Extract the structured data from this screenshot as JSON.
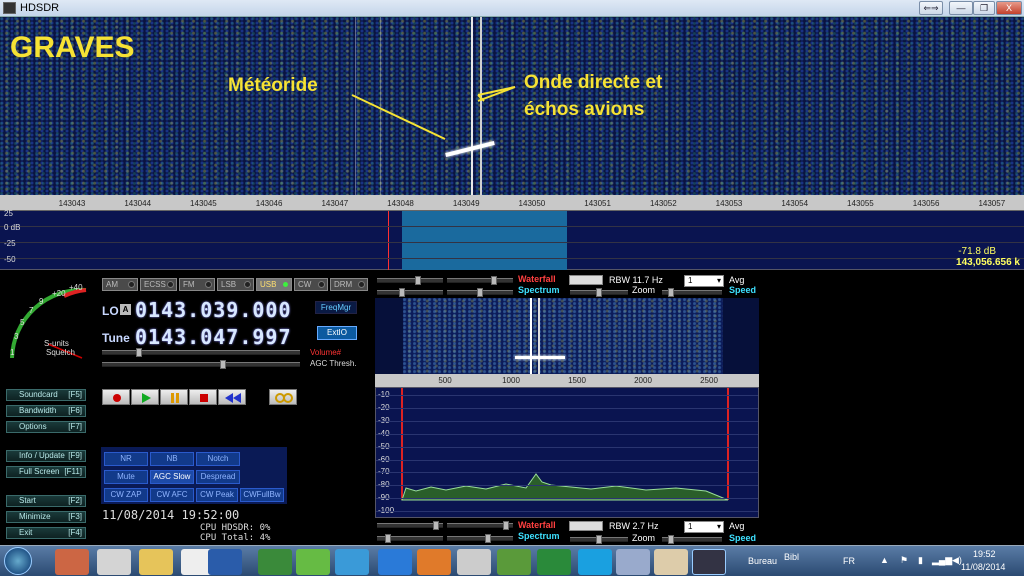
{
  "window": {
    "title": "HDSDR",
    "btn_restore": "⇐⇒",
    "btn_min": "—",
    "btn_max": "❐",
    "btn_close": "X"
  },
  "waterfall": {
    "label_site": "GRAVES",
    "label_meteor": "Météoride",
    "label_onde_line1": "Onde directe et",
    "label_onde_line2": "échos avions"
  },
  "freq_axis": {
    "ticks": [
      "143043",
      "143044",
      "143045",
      "143046",
      "143047",
      "143048",
      "143049",
      "143050",
      "143051",
      "143052",
      "143053",
      "143054",
      "143055",
      "143056",
      "143057"
    ]
  },
  "spectrum": {
    "db_labels": [
      "25",
      "0 dB",
      "-25",
      "-50"
    ],
    "readout_db": "-71.8 dB",
    "readout_freq": "143,056.656 k"
  },
  "modes": [
    {
      "label": "AM",
      "on": false
    },
    {
      "label": "ECSS",
      "on": false
    },
    {
      "label": "FM",
      "on": false
    },
    {
      "label": "LSB",
      "on": false
    },
    {
      "label": "USB",
      "on": true
    },
    {
      "label": "CW",
      "on": false
    },
    {
      "label": "DRM",
      "on": false
    }
  ],
  "meter": {
    "label1": "S-units",
    "label2": "Squelch",
    "scale": [
      "1",
      "3",
      "5",
      "7",
      "9",
      "+20",
      "+40"
    ]
  },
  "lo": {
    "label": "LO",
    "lock": "A",
    "value": "0143.039.000"
  },
  "tune": {
    "label": "Tune",
    "value": "0143.047.997"
  },
  "buttons": {
    "freqmgr": "FreqMgr",
    "extio": "ExtIO",
    "volume": "Volume#",
    "agc": "AGC Thresh."
  },
  "side_buttons": [
    {
      "label": "Soundcard",
      "key": "[F5]"
    },
    {
      "label": "Bandwidth",
      "key": "[F6]"
    },
    {
      "label": "Options",
      "key": "[F7]"
    },
    {
      "label": "Info / Update",
      "key": "[F9]"
    },
    {
      "label": "Full Screen",
      "key": "[F11]"
    },
    {
      "label": "Start",
      "key": "[F2]"
    },
    {
      "label": "Minimize",
      "key": "[F3]"
    },
    {
      "label": "Exit",
      "key": "[F4]"
    }
  ],
  "dsp": {
    "nr": "NR",
    "nb": "NB",
    "notch": "Notch",
    "mute": "Mute",
    "agc_slow": "AGC Slow",
    "despread": "Despread",
    "cw_zap": "CW ZAP",
    "cw_afc": "CW AFC",
    "cw_peak": "CW Peak",
    "cw_fullbw": "CWFullBw"
  },
  "status": {
    "datetime": "11/08/2014 19:52:00",
    "cpu_hdsdr": "CPU HDSDR: 0%",
    "cpu_total": "CPU Total: 4%"
  },
  "rf_controls": {
    "waterfall": "Waterfall",
    "spectrum": "Spectrum",
    "rbw": "RBW 11.7 Hz",
    "zoom": "Zoom",
    "avg_sel": "1",
    "avg": "Avg",
    "speed": "Speed"
  },
  "af_controls": {
    "waterfall": "Waterfall",
    "spectrum": "Spectrum",
    "rbw": "RBW  2.7 Hz",
    "zoom": "Zoom",
    "avg_sel": "1",
    "avg": "Avg",
    "speed": "Speed"
  },
  "af_axis": {
    "ticks": [
      "500",
      "1000",
      "1500",
      "2000",
      "2500"
    ]
  },
  "af_db": {
    "ticks": [
      "-10",
      "-20",
      "-30",
      "-40",
      "-50",
      "-60",
      "-70",
      "-80",
      "-90",
      "-100"
    ]
  },
  "taskbar": {
    "bureau": "Bureau",
    "bibl": "Bibl",
    "lang": "FR",
    "time": "19:52",
    "date": "11/08/2014"
  }
}
